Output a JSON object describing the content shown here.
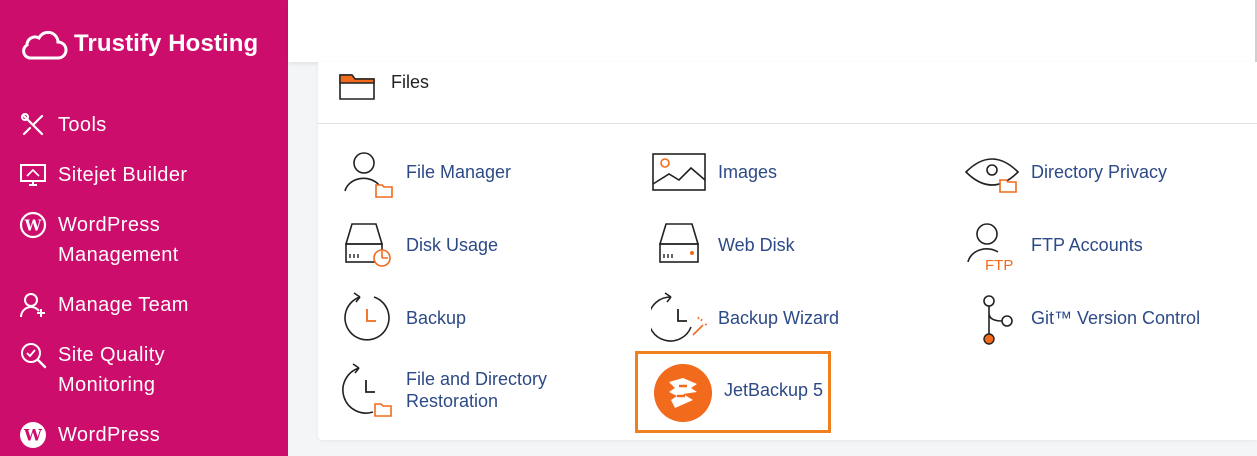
{
  "brand": {
    "name": "Trustify Hosting"
  },
  "sidebar": {
    "items": [
      {
        "label": "Tools",
        "icon": "tools-icon"
      },
      {
        "label": "Sitejet Builder",
        "icon": "sitejet-icon"
      },
      {
        "label_line1": "WordPress",
        "label_line2": "Management",
        "icon": "wordpress-icon"
      },
      {
        "label": "Manage Team",
        "icon": "manage-team-icon"
      },
      {
        "label_line1": "Site Quality",
        "label_line2": "Monitoring",
        "icon": "site-quality-icon"
      },
      {
        "label": "WordPress",
        "icon": "wordpress-icon"
      }
    ]
  },
  "files_section": {
    "title": "Files",
    "items": [
      {
        "label": "File Manager",
        "icon": "file-manager-icon"
      },
      {
        "label": "Images",
        "icon": "images-icon"
      },
      {
        "label": "Directory Privacy",
        "icon": "directory-privacy-icon"
      },
      {
        "label": "Disk Usage",
        "icon": "disk-usage-icon"
      },
      {
        "label": "Web Disk",
        "icon": "web-disk-icon"
      },
      {
        "label": "FTP Accounts",
        "icon": "ftp-accounts-icon"
      },
      {
        "label": "Backup",
        "icon": "backup-icon"
      },
      {
        "label": "Backup Wizard",
        "icon": "backup-wizard-icon"
      },
      {
        "label": "Git™ Version Control",
        "icon": "git-icon"
      },
      {
        "label_line1": "File and Directory",
        "label_line2": "Restoration",
        "icon": "restoration-icon"
      },
      {
        "label": "JetBackup 5",
        "icon": "jetbackup-icon"
      }
    ],
    "ftp_badge": "FTP"
  },
  "colors": {
    "sidebar": "#cc0d6c",
    "link": "#2d4a86",
    "accent_orange": "#f26a1b",
    "highlight_border": "#f0801e"
  }
}
